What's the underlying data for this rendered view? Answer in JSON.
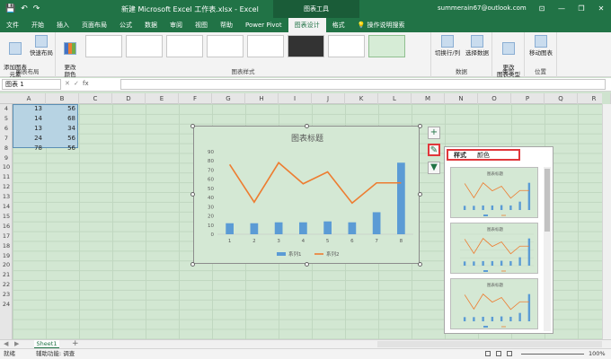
{
  "titlebar": {
    "title": "新建 Microsoft Excel 工作表.xlsx - Excel",
    "context_tab": "图表工具",
    "user": "summerain67@outlook.com",
    "min": "—",
    "restore": "❐",
    "close": "✕",
    "options": "⊡"
  },
  "tabs": [
    "文件",
    "开始",
    "插入",
    "页面布局",
    "公式",
    "数据",
    "审阅",
    "视图",
    "帮助",
    "Power Pivot",
    "图表设计",
    "格式"
  ],
  "tell_me": "操作说明搜索",
  "ribbon": {
    "add_element": "添加图表\n元素",
    "quick_layout": "快速布局",
    "change_color": "更改\n颜色",
    "layout_group": "图表布局",
    "styles_group": "图表样式",
    "switch_rowcol": "切换行/列",
    "select_data": "选择数据",
    "data_group": "数据",
    "change_type": "更改\n图表类型",
    "type_group": "类型",
    "move_chart": "移动图表",
    "location_group": "位置"
  },
  "formula_bar": {
    "name_box": "图表 1",
    "fx": "fx",
    "cancel": "✕",
    "enter": "✓"
  },
  "columns": [
    "A",
    "B",
    "C",
    "D",
    "E",
    "F",
    "G",
    "H",
    "I",
    "J",
    "K",
    "L",
    "M",
    "N",
    "O",
    "P",
    "Q",
    "R"
  ],
  "rows": [
    "4",
    "5",
    "6",
    "7",
    "8",
    "9",
    "10",
    "11",
    "12",
    "13",
    "14",
    "15",
    "16",
    "17",
    "18",
    "19",
    "20",
    "21",
    "22",
    "23",
    "24"
  ],
  "cells": {
    "A": [
      "13",
      "14",
      "13",
      "24",
      "78"
    ],
    "B": [
      "56",
      "68",
      "34",
      "56",
      "56"
    ]
  },
  "chart": {
    "title": "图表标题",
    "legend": [
      "系列1",
      "系列2"
    ]
  },
  "chart_data": {
    "type": "bar",
    "title": "图表标题",
    "categories": [
      "1",
      "2",
      "3",
      "4",
      "5",
      "6",
      "7",
      "8"
    ],
    "yticks": [
      "0",
      "10",
      "20",
      "30",
      "40",
      "50",
      "60",
      "70",
      "80",
      "90"
    ],
    "ylim": [
      0,
      90
    ],
    "series": [
      {
        "name": "系列1",
        "kind": "bar",
        "color": "#5b9bd5",
        "values": [
          12,
          12,
          13,
          13,
          14,
          13,
          24,
          78
        ]
      },
      {
        "name": "系列2",
        "kind": "line",
        "color": "#ed7d31",
        "values": [
          76,
          35,
          78,
          55,
          68,
          34,
          56,
          56
        ]
      }
    ],
    "legend": "bottom",
    "grid": false
  },
  "panel": {
    "tab_style": "样式",
    "tab_color": "颜色",
    "thumb_titles": [
      "图表标题",
      "图表标题",
      "图表标题"
    ]
  },
  "sheet": {
    "tab": "Sheet1",
    "add": "+"
  },
  "status": {
    "ready": "就绪",
    "accessibility": "辅助功能: 调查",
    "zoom": "100%"
  },
  "colors": {
    "accent": "#217346",
    "highlight": "#e0373b"
  }
}
